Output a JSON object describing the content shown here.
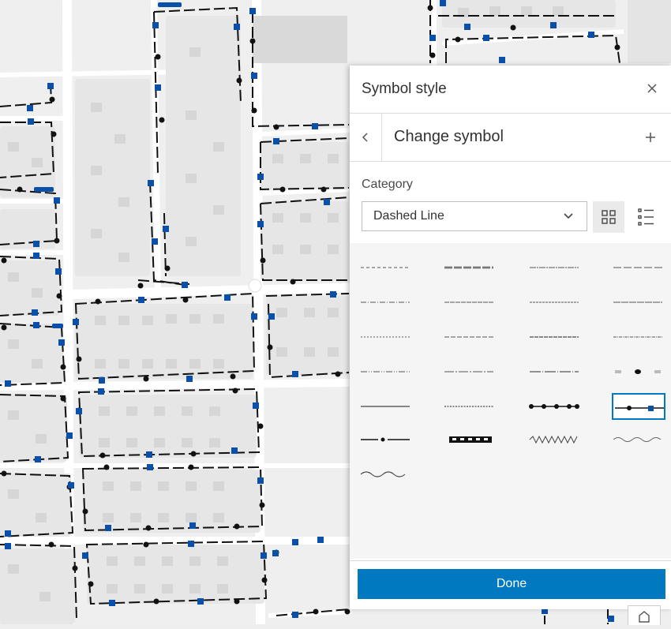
{
  "panel": {
    "title": "Symbol style",
    "subtitle": "Change symbol",
    "category_label": "Category",
    "category_value": "Dashed Line",
    "done_label": "Done"
  },
  "icons": {
    "close": "close-icon",
    "back": "chevron-left-icon",
    "add": "plus-icon",
    "dropdown": "chevron-down-icon",
    "grid_view": "grid-view-icon",
    "list_view": "list-view-icon",
    "home": "home-icon"
  },
  "colors": {
    "accent": "#0079c1",
    "line_black": "#111111",
    "marker_blue": "#0a4fa8"
  },
  "symbols": [
    {
      "style": "dash-short",
      "selected": false
    },
    {
      "style": "dash-double",
      "selected": false
    },
    {
      "style": "dash-long-dot",
      "selected": false
    },
    {
      "style": "dash-long",
      "selected": false
    },
    {
      "style": "dash-dot",
      "selected": false
    },
    {
      "style": "dash-fine",
      "selected": false
    },
    {
      "style": "dash-fine-2",
      "selected": false
    },
    {
      "style": "dash-fine-3",
      "selected": false
    },
    {
      "style": "dot-fine",
      "selected": false
    },
    {
      "style": "dash-medium",
      "selected": false
    },
    {
      "style": "dash-double-2",
      "selected": false
    },
    {
      "style": "dash-dot-fine",
      "selected": false
    },
    {
      "style": "dash-dot-dot",
      "selected": false
    },
    {
      "style": "dash-dot-long",
      "selected": false
    },
    {
      "style": "dash-dot-long-2",
      "selected": false
    },
    {
      "style": "gray-dot-gray",
      "selected": false
    },
    {
      "style": "solid",
      "selected": false
    },
    {
      "style": "dotted",
      "selected": false
    },
    {
      "style": "line-dots",
      "selected": false
    },
    {
      "style": "line-dot-square",
      "selected": true
    },
    {
      "style": "dash-dot-dash",
      "selected": false
    },
    {
      "style": "railroad",
      "selected": false
    },
    {
      "style": "zigzag",
      "selected": false
    },
    {
      "style": "wave-thin",
      "selected": false
    },
    {
      "style": "wave",
      "selected": false
    }
  ]
}
